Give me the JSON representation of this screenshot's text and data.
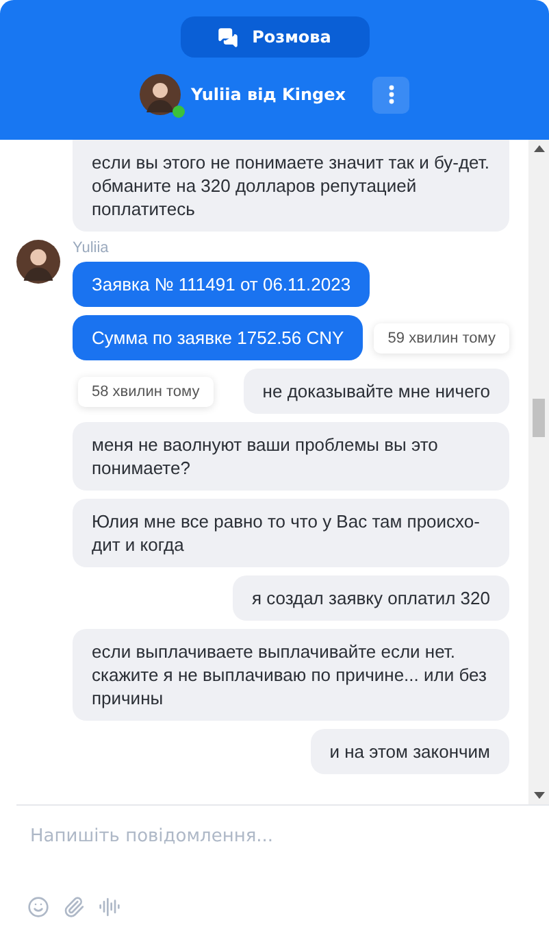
{
  "header": {
    "tab_button": "Розмова",
    "agent_name": "Yuliia від Kingex",
    "online": true
  },
  "messages": [
    {
      "kind": "user",
      "text": "если вы этого не понимаете значит так и бу-дет. обманите на 320 долларов репутацией поплатитесь"
    },
    {
      "kind": "agent",
      "author": "Yuliia",
      "text": "Заявка № 111491 от 06.11.2023"
    },
    {
      "kind": "agent",
      "text": "Сумма по заявке 1752.56 CNY",
      "tooltip": "59 хвилин тому"
    },
    {
      "kind": "user",
      "text": "не доказывайте мне ничего",
      "tooltip": "58 хвилин тому"
    },
    {
      "kind": "user",
      "text": "меня не ваолнуют ваши проблемы вы это понимаете?"
    },
    {
      "kind": "user",
      "text": "Юлия мне все равно то что у Вас там происхо-дит и когда"
    },
    {
      "kind": "user",
      "text": "я создал заявку оплатил 320"
    },
    {
      "kind": "user",
      "text": "если выплачиваете выплачивайте если нет. скажите я не выплачиваю по причине... или без причины"
    },
    {
      "kind": "user",
      "text": "и на этом закончим"
    }
  ],
  "composer": {
    "placeholder": "Напишіть повідомлення..."
  }
}
